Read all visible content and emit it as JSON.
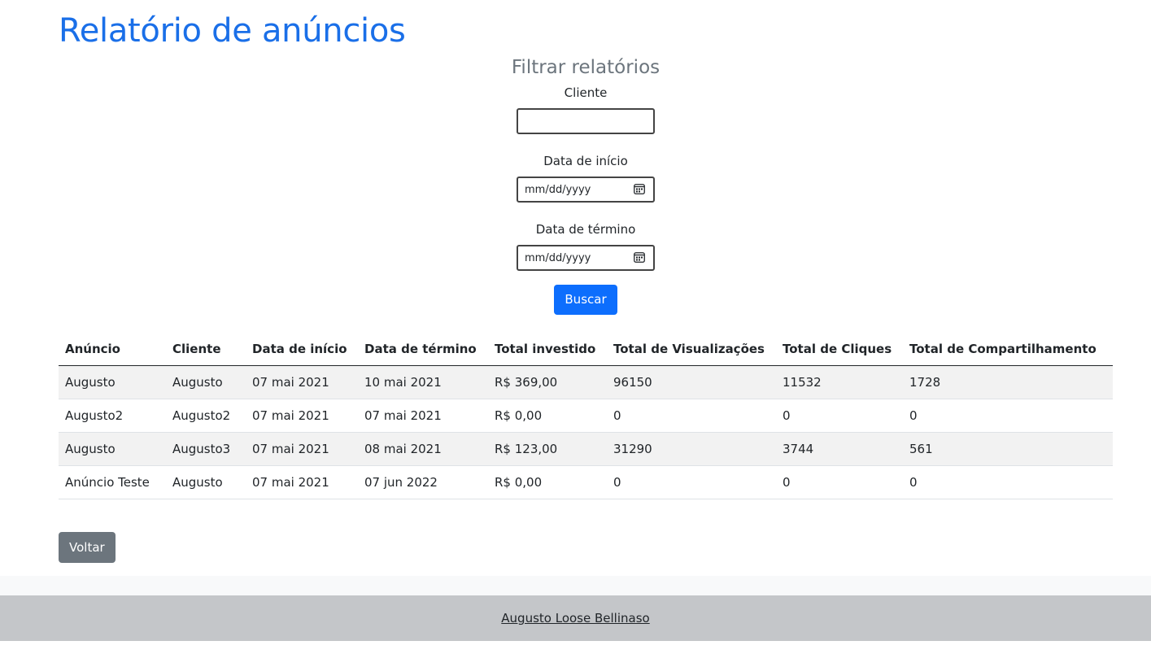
{
  "header": {
    "title": "Relatório de anúncios"
  },
  "filter": {
    "title": "Filtrar relatórios",
    "client_label": "Cliente",
    "client_value": "",
    "start_label": "Data de início",
    "start_placeholder": "mm/dd/yyyy",
    "end_label": "Data de término",
    "end_placeholder": "mm/dd/yyyy",
    "search_button": "Buscar"
  },
  "table": {
    "columns": [
      "Anúncio",
      "Cliente",
      "Data de início",
      "Data de término",
      "Total investido",
      "Total de Visualizações",
      "Total de Cliques",
      "Total de Compartilhamento"
    ],
    "rows": [
      [
        "Augusto",
        "Augusto",
        "07 mai 2021",
        "10 mai 2021",
        "R$ 369,00",
        "96150",
        "11532",
        "1728"
      ],
      [
        "Augusto2",
        "Augusto2",
        "07 mai 2021",
        "07 mai 2021",
        "R$ 0,00",
        "0",
        "0",
        "0"
      ],
      [
        "Augusto",
        "Augusto3",
        "07 mai 2021",
        "08 mai 2021",
        "R$ 123,00",
        "31290",
        "3744",
        "561"
      ],
      [
        "Anúncio Teste",
        "Augusto",
        "07 mai 2021",
        "07 jun 2022",
        "R$ 0,00",
        "0",
        "0",
        "0"
      ]
    ]
  },
  "back_button": "Voltar",
  "footer": {
    "author_link": "Augusto Loose Bellinaso"
  },
  "colors": {
    "title": "#1a6fe8",
    "primary": "#0d6efd",
    "secondary": "#6c757d",
    "footer_bg": "#c4c6c9"
  }
}
